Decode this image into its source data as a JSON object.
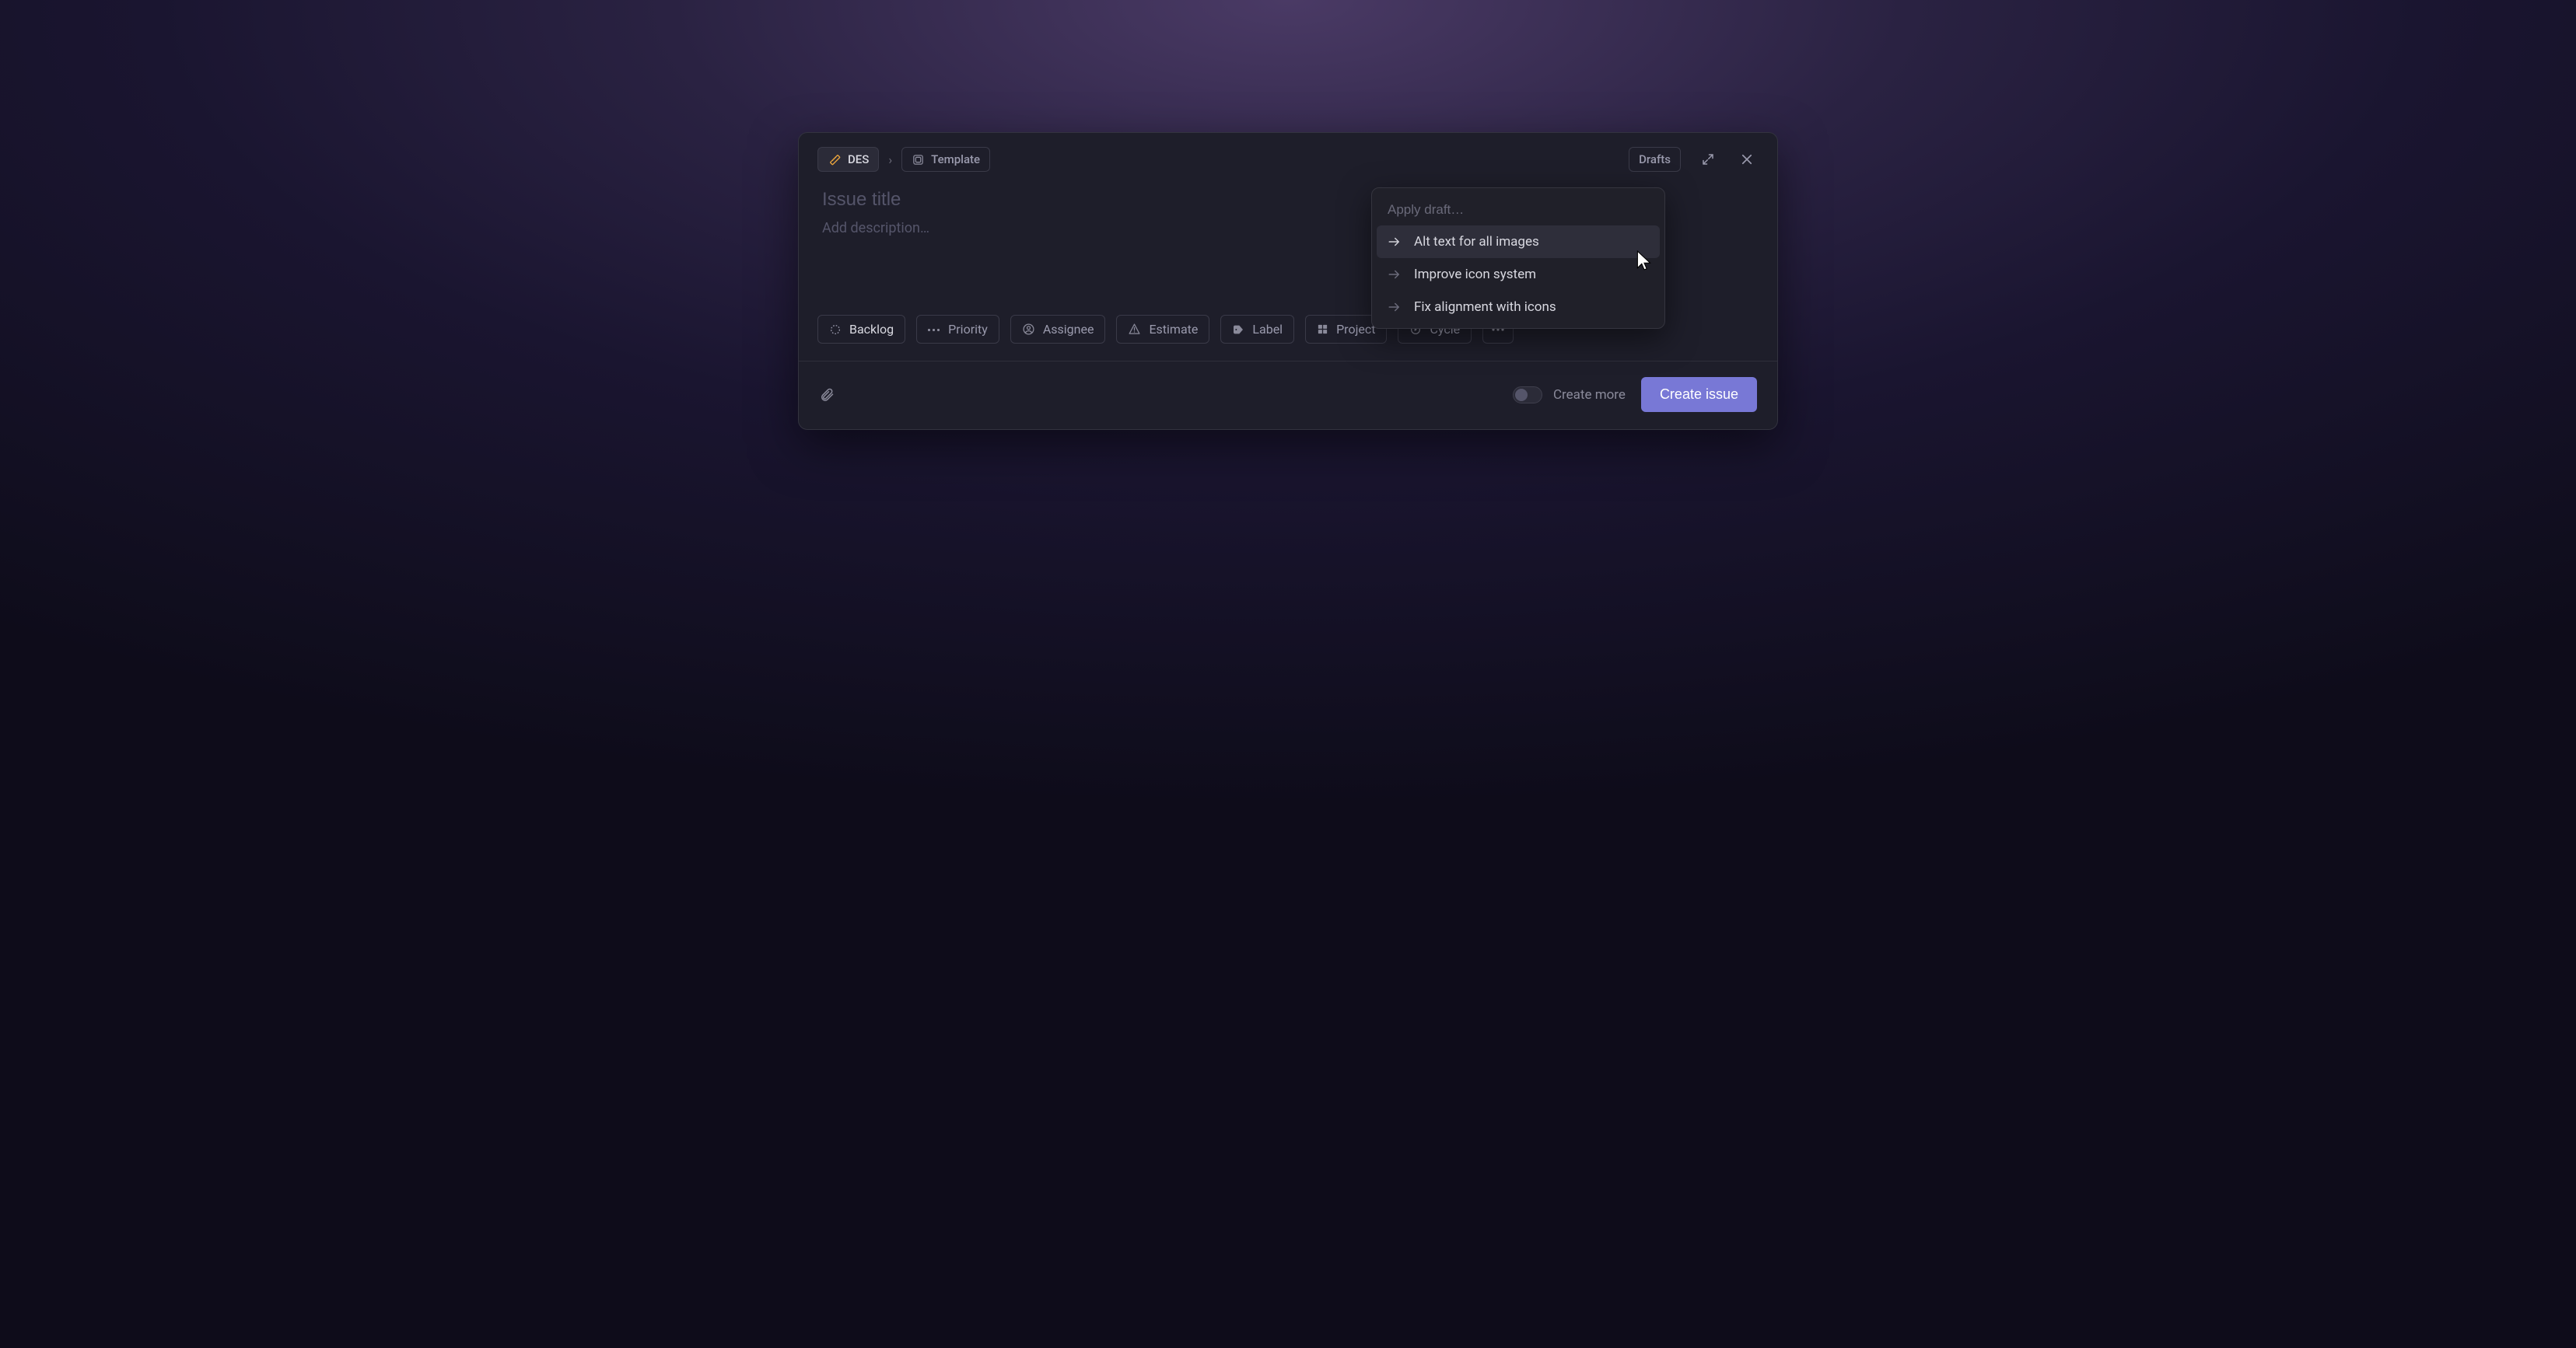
{
  "header": {
    "team_code": "DES",
    "template_label": "Template",
    "drafts_label": "Drafts"
  },
  "body": {
    "title_placeholder": "Issue title",
    "description_placeholder": "Add description…"
  },
  "props": {
    "backlog": "Backlog",
    "priority": "Priority",
    "assignee": "Assignee",
    "estimate": "Estimate",
    "label": "Label",
    "project": "Project",
    "cycle": "Cycle"
  },
  "footer": {
    "create_more_label": "Create more",
    "submit_label": "Create issue"
  },
  "drafts": {
    "search_placeholder": "Apply draft…",
    "items": [
      {
        "label": "Alt text for all images",
        "active": true
      },
      {
        "label": "Improve icon system",
        "active": false
      },
      {
        "label": "Fix alignment with icons",
        "active": false
      }
    ]
  }
}
